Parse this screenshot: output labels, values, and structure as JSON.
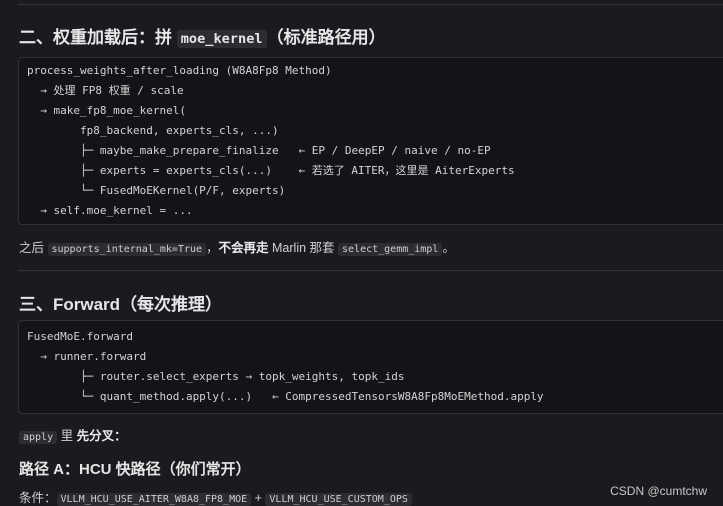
{
  "section2": {
    "title_prefix": "二、权重加载后：拼",
    "title_code": "moe_kernel",
    "title_suffix": "（标准路径用）",
    "code_lines": [
      "process_weights_after_loading (W8A8Fp8 Method)",
      "  → 处理 FP8 权重 / scale",
      "  → make_fp8_moe_kernel(",
      "        fp8_backend, experts_cls, ...)",
      "        ├─ maybe_make_prepare_finalize   ← EP / DeepEP / naive / no-EP",
      "        ├─ experts = experts_cls(...)    ← 若选了 AITER，这里是 AiterExperts",
      "        └─ FusedMoEKernel(P/F, experts)",
      "  → self.moe_kernel = ..."
    ],
    "note_pre": "之后",
    "note_code1": "supports_internal_mk=True",
    "note_mid": "，",
    "note_bold": "不会再走",
    "note_post": " Marlin 那套",
    "note_code2": "select_gemm_impl",
    "note_end": "。"
  },
  "section3": {
    "title": "三、Forward（每次推理）",
    "code_lines": [
      "FusedMoE.forward",
      "  → runner.forward",
      "        ├─ router.select_experts → topk_weights, topk_ids",
      "        └─ quant_method.apply(...)   ← CompressedTensorsW8A8Fp8MoEMethod.apply"
    ],
    "apply_code": "apply",
    "apply_text": "里",
    "apply_bold": "先分叉",
    "apply_colon": "："
  },
  "pathA": {
    "title": "路径 A：HCU 快路径（你们常开）",
    "cond_label": "条件：",
    "cond_code1": "VLLM_HCU_USE_AITER_W8A8_FP8_MOE",
    "cond_plus": " + ",
    "cond_code2": "VLLM_HCU_USE_CUSTOM_OPS"
  },
  "watermark": "CSDN @cumtchw"
}
